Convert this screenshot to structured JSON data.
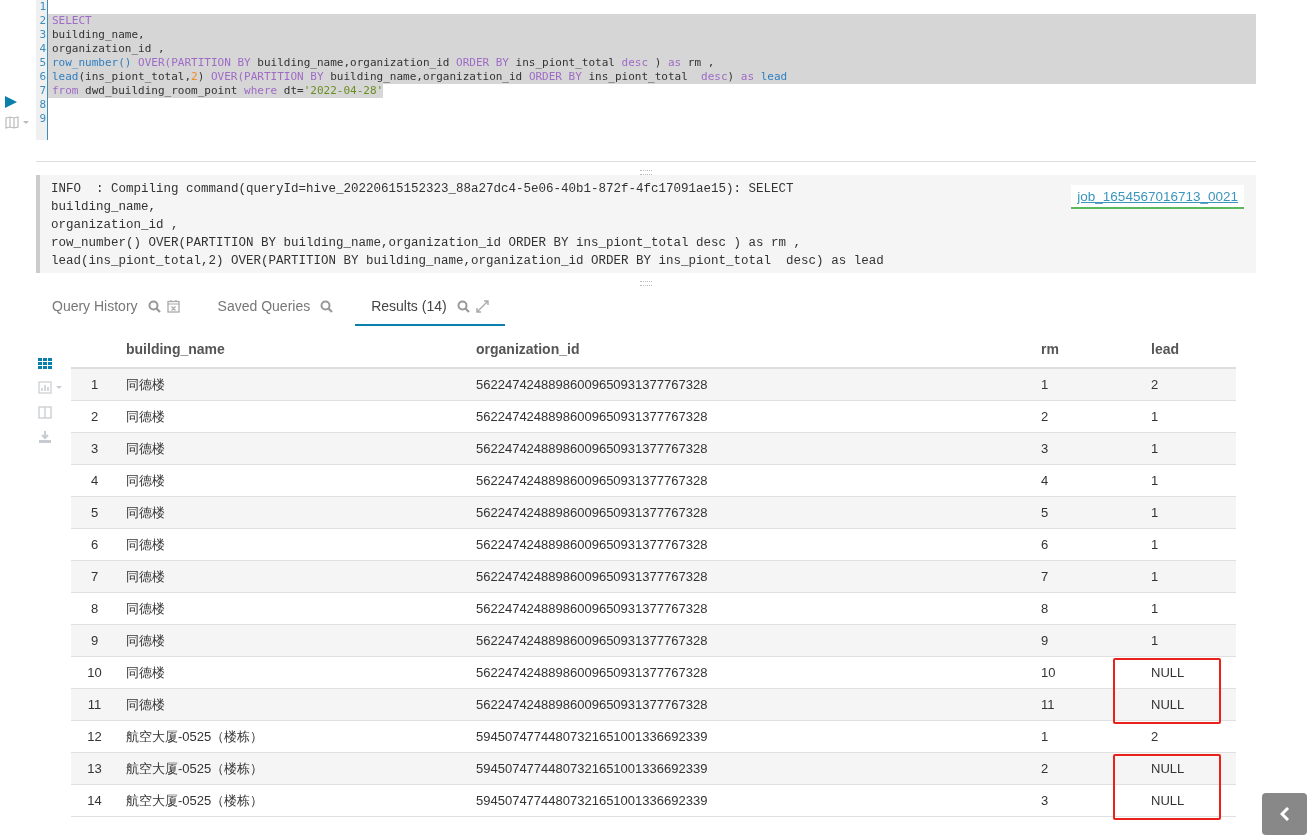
{
  "editor": {
    "lines": [
      {
        "number": "1",
        "selected": false
      },
      {
        "number": "2",
        "selected": true,
        "segments": [
          {
            "kind": "keyword",
            "text": "SELECT"
          }
        ]
      },
      {
        "number": "3",
        "selected": true,
        "segments": [
          {
            "kind": "plain",
            "text": "building_name,"
          }
        ]
      },
      {
        "number": "4",
        "selected": true,
        "segments": [
          {
            "kind": "plain",
            "text": "organization_id ,"
          }
        ]
      },
      {
        "number": "5",
        "selected": true,
        "segments": [
          {
            "kind": "function",
            "text": "row_number()"
          },
          {
            "kind": "keyword",
            "text": " OVER(PARTITION BY"
          },
          {
            "kind": "plain",
            "text": " building_name,organization_id "
          },
          {
            "kind": "keyword",
            "text": "ORDER BY"
          },
          {
            "kind": "plain",
            "text": " ins_piont_total "
          },
          {
            "kind": "keyword",
            "text": "desc"
          },
          {
            "kind": "plain",
            "text": " ) "
          },
          {
            "kind": "keyword",
            "text": "as"
          },
          {
            "kind": "plain",
            "text": " rm ,"
          }
        ]
      },
      {
        "number": "6",
        "selected": true,
        "segments": [
          {
            "kind": "function",
            "text": "lead"
          },
          {
            "kind": "plain",
            "text": "(ins_piont_total,"
          },
          {
            "kind": "number",
            "text": "2"
          },
          {
            "kind": "plain",
            "text": ") "
          },
          {
            "kind": "keyword",
            "text": "OVER(PARTITION BY"
          },
          {
            "kind": "plain",
            "text": " building_name,organization_id "
          },
          {
            "kind": "keyword",
            "text": "ORDER BY"
          },
          {
            "kind": "plain",
            "text": " ins_piont_total  "
          },
          {
            "kind": "keyword",
            "text": "desc"
          },
          {
            "kind": "plain",
            "text": ") "
          },
          {
            "kind": "keyword",
            "text": "as"
          },
          {
            "kind": "function",
            "text": " lead"
          }
        ]
      },
      {
        "number": "7",
        "selected": true,
        "segments": [
          {
            "kind": "keyword",
            "text": "from"
          },
          {
            "kind": "plain",
            "text": " dwd_building_room_point "
          },
          {
            "kind": "keyword",
            "text": "where"
          },
          {
            "kind": "plain",
            "text": " dt="
          },
          {
            "kind": "string",
            "text": "'2022-04-28'"
          }
        ]
      },
      {
        "number": "8",
        "selected": false
      },
      {
        "number": "9",
        "selected": false
      }
    ]
  },
  "log": {
    "lines": [
      "INFO  : Compiling command(queryId=hive_20220615152323_88a27dc4-5e06-40b1-872f-4fc17091ae15): SELECT",
      "building_name,",
      "organization_id ,",
      "row_number() OVER(PARTITION BY building_name,organization_id ORDER BY ins_piont_total desc ) as rm ,",
      "lead(ins_piont_total,2) OVER(PARTITION BY building_name,organization_id ORDER BY ins_piont_total  desc) as lead"
    ],
    "job_link": "job_1654567016713_0021"
  },
  "tabs": [
    {
      "label": "Query History",
      "selected": false,
      "kind": "history"
    },
    {
      "label": "Saved Queries",
      "selected": false,
      "kind": "saved"
    },
    {
      "label": "Results (14)",
      "selected": true,
      "kind": "results"
    }
  ],
  "side_tools": [
    {
      "kind": "grid",
      "selected": true
    },
    {
      "kind": "chart",
      "selected": false
    },
    {
      "kind": "columns",
      "selected": false
    },
    {
      "kind": "download",
      "selected": false
    }
  ],
  "table": {
    "columns": [
      "",
      "building_name",
      "organization_id",
      "rm",
      "lead"
    ],
    "rows": [
      {
        "cells": [
          "1",
          "同德楼",
          "56224742488986009650931377767328",
          "1",
          "2"
        ],
        "boxed": false
      },
      {
        "cells": [
          "2",
          "同德楼",
          "56224742488986009650931377767328",
          "2",
          "1"
        ],
        "boxed": false
      },
      {
        "cells": [
          "3",
          "同德楼",
          "56224742488986009650931377767328",
          "3",
          "1"
        ],
        "boxed": false
      },
      {
        "cells": [
          "4",
          "同德楼",
          "56224742488986009650931377767328",
          "4",
          "1"
        ],
        "boxed": false
      },
      {
        "cells": [
          "5",
          "同德楼",
          "56224742488986009650931377767328",
          "5",
          "1"
        ],
        "boxed": false
      },
      {
        "cells": [
          "6",
          "同德楼",
          "56224742488986009650931377767328",
          "6",
          "1"
        ],
        "boxed": false
      },
      {
        "cells": [
          "7",
          "同德楼",
          "56224742488986009650931377767328",
          "7",
          "1"
        ],
        "boxed": false
      },
      {
        "cells": [
          "8",
          "同德楼",
          "56224742488986009650931377767328",
          "8",
          "1"
        ],
        "boxed": false
      },
      {
        "cells": [
          "9",
          "同德楼",
          "56224742488986009650931377767328",
          "9",
          "1"
        ],
        "boxed": false
      },
      {
        "cells": [
          "10",
          "同德楼",
          "56224742488986009650931377767328",
          "10",
          "NULL"
        ],
        "boxed": true
      },
      {
        "cells": [
          "11",
          "同德楼",
          "56224742488986009650931377767328",
          "11",
          "NULL"
        ],
        "boxed": true
      },
      {
        "cells": [
          "12",
          "航空大厦-0525（楼栋）",
          "59450747744807321651001336692339",
          "1",
          "2"
        ],
        "boxed": false
      },
      {
        "cells": [
          "13",
          "航空大厦-0525（楼栋）",
          "59450747744807321651001336692339",
          "2",
          "NULL"
        ],
        "boxed": true
      },
      {
        "cells": [
          "14",
          "航空大厦-0525（楼栋）",
          "59450747744807321651001336692339",
          "3",
          "NULL"
        ],
        "boxed": true
      }
    ]
  }
}
